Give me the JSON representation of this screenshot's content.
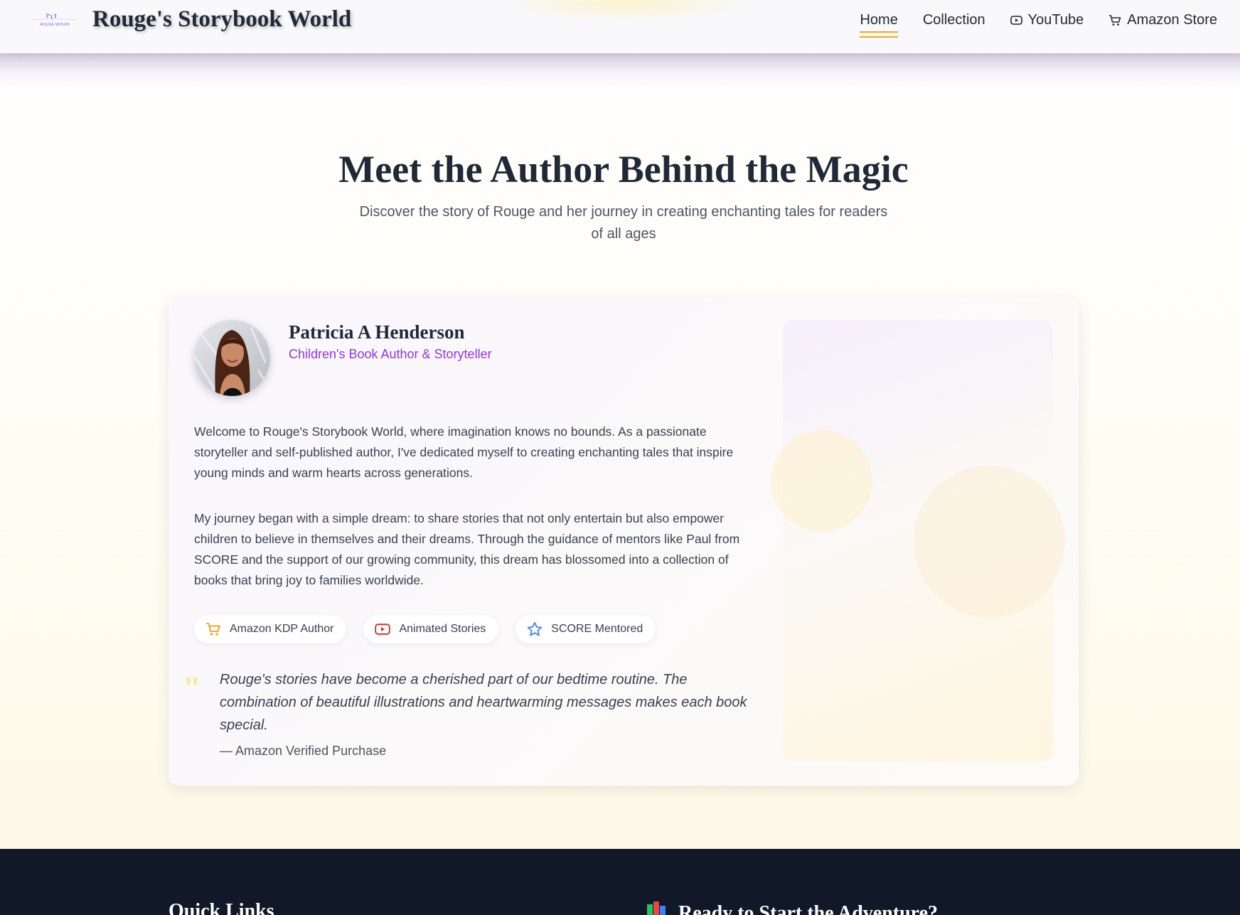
{
  "header": {
    "title": "Rouge's Storybook World",
    "logo_text": "ROUGE WITHIN",
    "nav": [
      {
        "label": "Home",
        "icon": null,
        "active": true
      },
      {
        "label": "Collection",
        "icon": null,
        "active": false
      },
      {
        "label": "YouTube",
        "icon": "youtube-icon",
        "active": false
      },
      {
        "label": "Amazon Store",
        "icon": "cart-icon",
        "active": false
      }
    ]
  },
  "hero": {
    "title": "Meet the Author Behind the Magic",
    "subtitle": "Discover the story of Rouge and her journey in creating enchanting tales for readers of all ages"
  },
  "author": {
    "name": "Patricia A Henderson",
    "role": "Children's Book Author & Storyteller",
    "paragraphs": [
      "Welcome to Rouge's Storybook World, where imagination knows no bounds. As a passionate storyteller and self-published author, I've dedicated myself to creating enchanting tales that inspire young minds and warm hearts across generations.",
      "My journey began with a simple dream: to share stories that not only entertain but also empower children to believe in themselves and their dreams. Through the guidance of mentors like Paul from SCORE and the support of our growing community, this dream has blossomed into a collection of books that bring joy to families worldwide."
    ],
    "badges": [
      {
        "label": "Amazon KDP Author",
        "icon": "cart-icon",
        "color": "#f59e0b"
      },
      {
        "label": "Animated Stories",
        "icon": "youtube-icon",
        "color": "#dc2626"
      },
      {
        "label": "SCORE Mentored",
        "icon": "star-icon",
        "color": "#3b82f6"
      }
    ],
    "quote": {
      "text": "Rouge's stories have become a cherished part of our bedtime routine. The combination of beautiful illustrations and heartwarming messages makes each book special.",
      "source": "— Amazon Verified Purchase"
    }
  },
  "footer": {
    "quick_links_title": "Quick Links",
    "cta_title": "Ready to Start the Adventure?",
    "cta_icon": "books-icon"
  },
  "colors": {
    "accent_gold": "#f0a81c",
    "accent_purple": "#9333ea",
    "footer_bg": "#111827"
  }
}
